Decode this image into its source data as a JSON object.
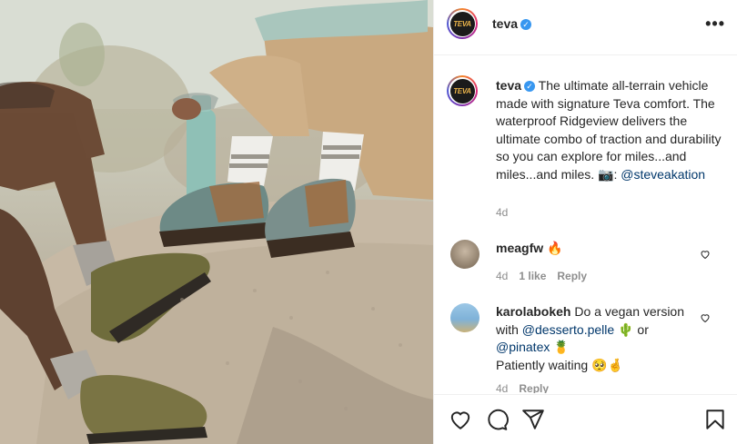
{
  "post": {
    "author": "teva",
    "avatar_text": "TEVA",
    "more_label": "•••",
    "verified_mark": "✓"
  },
  "caption": {
    "username": "teva",
    "text": "The ultimate all-terrain vehicle made with signature Teva comfort. The waterproof Ridgeview delivers the ultimate combo of traction and durability so you can explore for miles...and miles...and miles. 📷:",
    "mention": "@steveakation",
    "time": "4d"
  },
  "comments": [
    {
      "username": "meagfw",
      "text": "🔥",
      "time": "4d",
      "likes": "1 like",
      "reply": "Reply"
    },
    {
      "username": "karolabokeh",
      "text_1": "Do a vegan version with",
      "mention_1": "@desserto.pelle",
      "emoji_1": "🌵",
      "or_text": "or",
      "mention_2": "@pinatex",
      "emoji_2": "🍍",
      "text_2": "Patiently waiting",
      "emoji_3": "🥺🤞",
      "time": "4d",
      "reply": "Reply"
    }
  ],
  "colors": {
    "link": "#00376b",
    "meta": "#8e8e8e",
    "verified": "#3897f0"
  },
  "icons": [
    "heart-icon",
    "comment-icon",
    "share-icon",
    "bookmark-icon",
    "more-icon"
  ]
}
